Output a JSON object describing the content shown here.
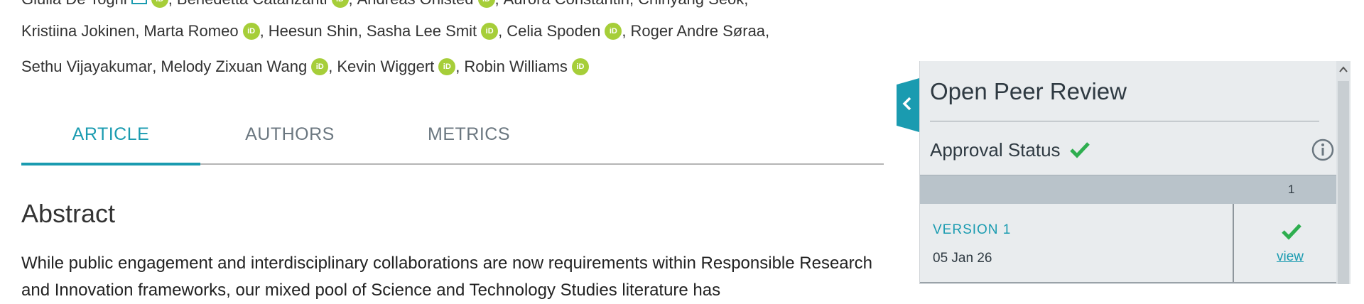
{
  "authors": {
    "line0": [
      {
        "name": "Giulia De Togni",
        "orcid": true,
        "mail": true
      },
      {
        "name": "Benedetta Catanzariti",
        "orcid": true
      },
      {
        "name": "Andreas Ohlsted",
        "orcid": true
      },
      {
        "name": "Aurora Constantin",
        "orcid": false
      },
      {
        "name": "Chinyang Seok",
        "orcid": false
      }
    ],
    "line1": [
      {
        "name": "Kristiina Jokinen",
        "orcid": false
      },
      {
        "name": "Marta Romeo",
        "orcid": true
      },
      {
        "name": "Heesun Shin",
        "orcid": false
      },
      {
        "name": "Sasha Lee Smit",
        "orcid": true
      },
      {
        "name": "Celia Spoden",
        "orcid": true
      },
      {
        "name": "Roger Andre Søraa",
        "orcid": false
      }
    ],
    "line2": [
      {
        "name": "Sethu Vijayakumar",
        "orcid": false
      },
      {
        "name": "Melody Zixuan Wang",
        "orcid": true
      },
      {
        "name": "Kevin Wiggert",
        "orcid": true
      },
      {
        "name": "Robin Williams",
        "orcid": true
      }
    ],
    "orcid_badge": "iD"
  },
  "tabs": {
    "article": "ARTICLE",
    "authors": "AUTHORS",
    "metrics": "METRICS",
    "active": "article"
  },
  "abstract": {
    "heading": "Abstract",
    "text": "While public engagement and interdisciplinary collaborations are now requirements within Responsible Research and Innovation frameworks, our mixed pool of Science and Technology Studies literature has"
  },
  "review_panel": {
    "title": "Open Peer Review",
    "approval_label": "Approval Status",
    "approval_icon": "check-icon",
    "info_icon": "info-icon",
    "reviewer_column": "1",
    "versions": [
      {
        "label": "VERSION 1",
        "date": "05 Jan 26",
        "review_status": "approved",
        "view_label": "view"
      }
    ]
  },
  "colors": {
    "accent": "#1a9bb0",
    "orcid": "#a6ce39",
    "approved": "#2eae4f",
    "panel_bg": "#e9ecee",
    "header_bg": "#b9c3ca"
  }
}
